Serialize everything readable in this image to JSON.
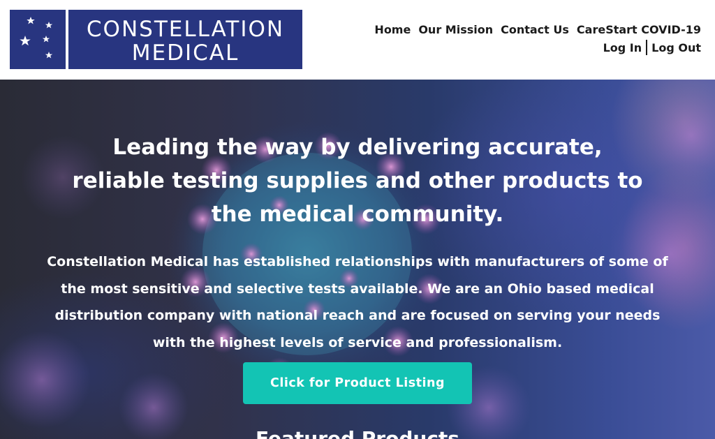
{
  "logo": {
    "line1": "CONSTELLATION",
    "line2": "MEDICAL",
    "background_color": "#283580"
  },
  "nav": {
    "items": [
      "Home",
      "Our Mission",
      "Contact Us",
      "CareStart COVID-19"
    ]
  },
  "auth": {
    "login": "Log In",
    "logout": "Log Out"
  },
  "hero": {
    "title": "Leading the way by delivering accurate, reliable testing supplies and other products to the medical community.",
    "description": "Constellation Medical has established relationships with manufacturers of some of the most sensitive and selective tests available. We are an Ohio based medical distribution company with national reach and are focused on serving your needs with the highest levels of service and professionalism.",
    "cta_label": "Click for Product Listing",
    "cta_color": "#13c4b4",
    "section_heading": "Featured Products",
    "background_image": "coronavirus-illustration"
  }
}
